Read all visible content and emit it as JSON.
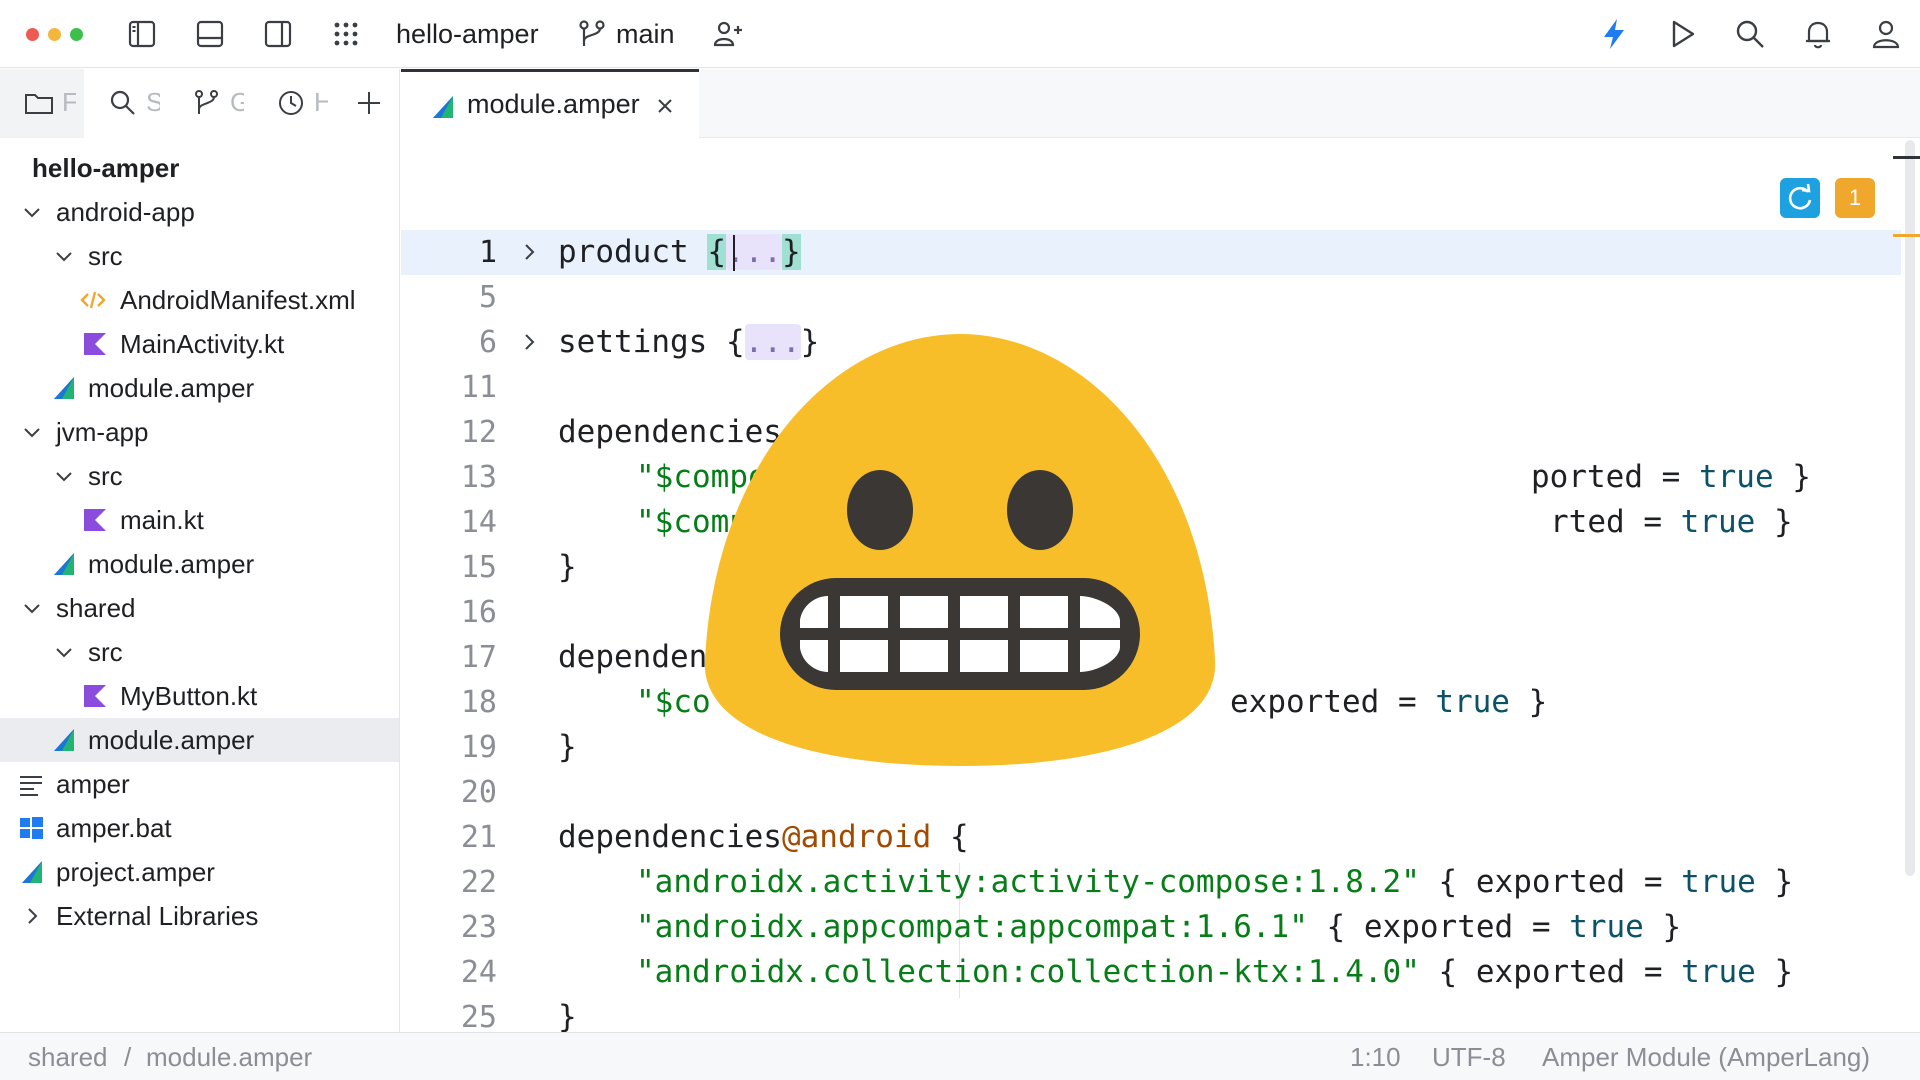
{
  "window": {
    "project_name": "hello-amper",
    "branch": "main"
  },
  "sidebar": {
    "tabs": [
      {
        "letter": "F"
      },
      {
        "letter": "S"
      },
      {
        "letter": "G"
      },
      {
        "letter": "H"
      }
    ],
    "tree": [
      {
        "label": "hello-amper"
      },
      {
        "label": "android-app"
      },
      {
        "label": "src"
      },
      {
        "label": "AndroidManifest.xml"
      },
      {
        "label": "MainActivity.kt"
      },
      {
        "label": "module.amper"
      },
      {
        "label": "jvm-app"
      },
      {
        "label": "src"
      },
      {
        "label": "main.kt"
      },
      {
        "label": "module.amper"
      },
      {
        "label": "shared"
      },
      {
        "label": "src"
      },
      {
        "label": "MyButton.kt"
      },
      {
        "label": "module.amper"
      },
      {
        "label": "amper"
      },
      {
        "label": "amper.bat"
      },
      {
        "label": "project.amper"
      },
      {
        "label": "External Libraries"
      }
    ]
  },
  "editor": {
    "tab_label": "module.amper",
    "line_numbers": [
      "1",
      "5",
      "6",
      "11",
      "12",
      "13",
      "14",
      "15",
      "16",
      "17",
      "18",
      "19",
      "20",
      "21",
      "22",
      "23",
      "24",
      "25"
    ],
    "code": {
      "l1_kw": "product ",
      "l1_open": "{",
      "l1_fold": "...",
      "l1_close": "}",
      "l6_kw": "settings ",
      "l6_open": "{",
      "l6_fold": "...",
      "l6_close": "}",
      "l12": "dependencies {",
      "l13_str": "\"$compos",
      "l13_rest": "ported = ",
      "l13_bool": "true",
      "l13_end": " }",
      "l14_str": "\"$comp",
      "l14_rest": "rted = ",
      "l14_bool": "true",
      "l14_end": " }",
      "l15": "}",
      "l17": "dependen",
      "l18_str": "\"$co",
      "l18_rest": "exported = ",
      "l18_bool": "true",
      "l18_end": " }",
      "l19": "}",
      "l21_kw": "dependencies",
      "l21_at": "@android",
      "l21_end": " {",
      "l22_str": "\"androidx.activity:activity-compose:1.8.2\"",
      "l22_rest": " { exported = ",
      "l22_bool": "true",
      "l22_end": " }",
      "l23_str": "\"androidx.appcompat:appcompat:1.6.1\"",
      "l23_rest": " { exported = ",
      "l23_bool": "true",
      "l23_end": " }",
      "l24_str": "\"androidx.collection:collection-ktx:1.4.0\"",
      "l24_rest": " { exported = ",
      "l24_bool": "true",
      "l24_end": " }",
      "l25": "}"
    },
    "warning_count": "1"
  },
  "overlay": {
    "emoji": "grimacing-face"
  },
  "statusbar": {
    "breadcrumb_1": "shared",
    "breadcrumb_sep": "/",
    "breadcrumb_2": "module.amper",
    "caret": "1:10",
    "encoding": "UTF-8",
    "file_type": "Amper Module (AmperLang)"
  },
  "colors": {
    "accent_blue": "#1e7bf0",
    "kotlin_purple": "#8b4bdc",
    "amper_green": "#21b573",
    "amper_blue": "#1d76d6",
    "string_green": "#067d17",
    "warning_orange": "#efa72c",
    "emoji_yellow": "#f8be2a"
  }
}
